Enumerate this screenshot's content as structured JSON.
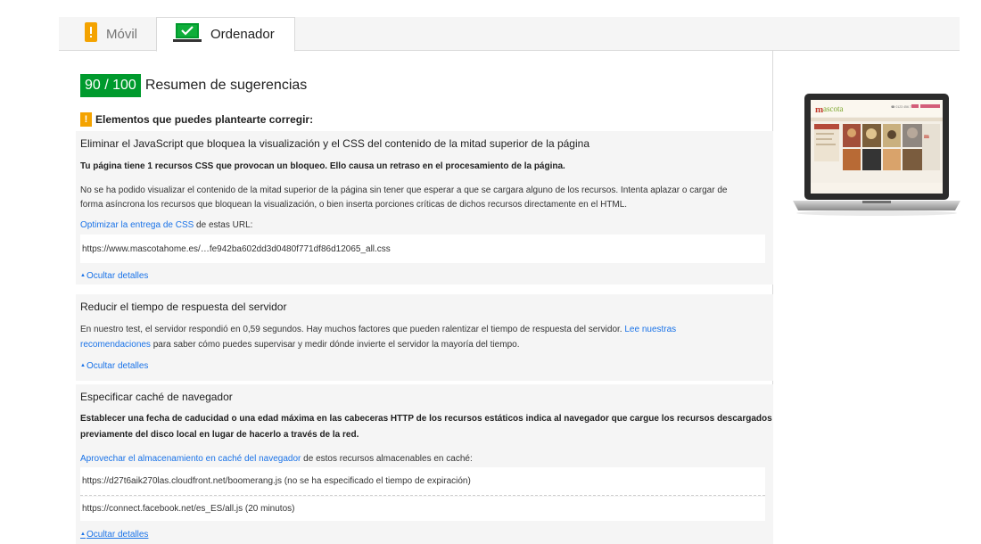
{
  "tabs": {
    "movil": "Móvil",
    "ordenador": "Ordenador"
  },
  "summary": {
    "score": "90 / 100",
    "title": "Resumen de sugerencias"
  },
  "warning": {
    "icon": "!",
    "title": "Elementos que puedes plantearte corregir:"
  },
  "rules": [
    {
      "title": "Eliminar el JavaScript que bloquea la visualización y el CSS del contenido de la mitad superior de la página",
      "bold": "Tu página tiene 1 recursos CSS que provocan un bloqueo. Ello causa un retraso en el procesamiento de la página.",
      "text_line1": "No se ha podido visualizar el contenido de la mitad superior de la página sin tener que esperar a que se cargara alguno de los recursos. Intenta aplazar o cargar de",
      "text_line2": "forma asíncrona los recursos que bloquean la visualización, o bien inserta porciones críticas de dichos recursos directamente en el HTML.",
      "link": "Optimizar la entrega de CSS",
      "link_suffix": " de estas URL:",
      "urls": [
        "https://www.mascotahome.es/…fe942ba602dd3d0480f771df86d12065_all.css"
      ],
      "hide": "Ocultar detalles"
    },
    {
      "title": "Reducir el tiempo de respuesta del servidor",
      "text_a": "En nuestro test, el servidor respondió en 0,59 segundos. Hay muchos factores que pueden ralentizar el tiempo de respuesta del servidor. ",
      "link1": "Lee nuestras",
      "link2": "recomendaciones",
      "text_b": " para saber cómo puedes supervisar y medir dónde invierte el servidor la mayoría del tiempo.",
      "hide": "Ocultar detalles"
    },
    {
      "title": "Especificar caché de navegador",
      "bold_line1": "Establecer una fecha de caducidad o una edad máxima en las cabeceras HTTP de los recursos estáticos indica al navegador que cargue los recursos descargados",
      "bold_line2": "previamente del disco local en lugar de hacerlo a través de la red.",
      "link": "Aprovechar el almacenamiento en caché del navegador",
      "link_suffix": " de estos recursos almacenables en caché:",
      "urls": [
        "https://d27t6aik270las.cloudfront.net/boomerang.js (no se ha especificado el tiempo de expiración)",
        "https://connect.facebook.net/es_ES/all.js (20 minutos)"
      ],
      "hide": "Ocultar detalles"
    }
  ],
  "preview": {
    "phone": "☎ 0123 456 789"
  },
  "colors": {
    "score_green": "#009a2d",
    "warning_orange": "#f4a300",
    "link_blue": "#1a73e8"
  }
}
